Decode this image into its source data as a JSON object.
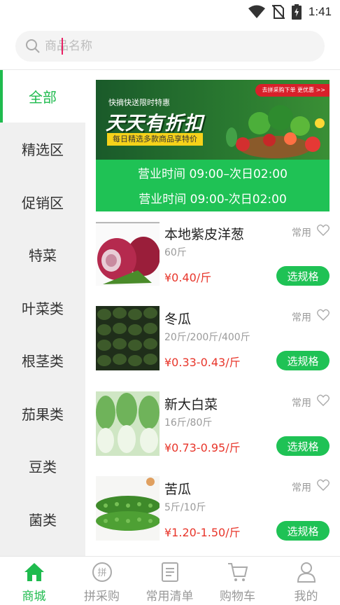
{
  "status_bar": {
    "time": "1:41",
    "icons": [
      "wifi-icon",
      "no-sim-icon",
      "battery-charging-icon"
    ]
  },
  "search": {
    "placeholder": "商品名称",
    "value": ""
  },
  "sidebar": {
    "active_index": 0,
    "items": [
      {
        "label": "全部"
      },
      {
        "label": "精选区"
      },
      {
        "label": "促销区"
      },
      {
        "label": "特菜"
      },
      {
        "label": "叶菜类"
      },
      {
        "label": "根茎类"
      },
      {
        "label": "茄果类"
      },
      {
        "label": "豆类"
      },
      {
        "label": "菌类"
      }
    ]
  },
  "banner": {
    "small_text": "快摘快送限时特惠",
    "big_text": "天天有折扣",
    "yellow_text": "每日精选多款商品享特价",
    "tag_text": "去拼采购下单 更优惠 >>",
    "hours_1": "营业时间  09:00–次日02:00",
    "hours_2": "营业时间  09:00-次日02:00"
  },
  "products": [
    {
      "name": "本地紫皮洋葱",
      "spec": "60斤",
      "price": "¥0.40/斤",
      "common": "常用",
      "button": "选规格",
      "image": "red-onion"
    },
    {
      "name": "冬瓜",
      "spec": "20斤/200斤/400斤",
      "price": "¥0.33-0.43/斤",
      "common": "常用",
      "button": "选规格",
      "image": "winter-melon"
    },
    {
      "name": "新大白菜",
      "spec": "16斤/80斤",
      "price": "¥0.73-0.95/斤",
      "common": "常用",
      "button": "选规格",
      "image": "chinese-cabbage"
    },
    {
      "name": "苦瓜",
      "spec": "5斤/10斤",
      "price": "¥1.20-1.50/斤",
      "common": "常用",
      "button": "选规格",
      "image": "bitter-melon"
    }
  ],
  "bottom_nav": {
    "active_index": 0,
    "items": [
      {
        "label": "商城",
        "icon": "home-icon"
      },
      {
        "label": "拼采购",
        "icon": "group-buy-icon"
      },
      {
        "label": "常用清单",
        "icon": "list-icon"
      },
      {
        "label": "购物车",
        "icon": "cart-icon"
      },
      {
        "label": "我的",
        "icon": "user-icon"
      }
    ]
  },
  "colors": {
    "accent": "#1fbb4e",
    "price": "#e8352a",
    "sidebar_bg": "#f0f0f0"
  }
}
